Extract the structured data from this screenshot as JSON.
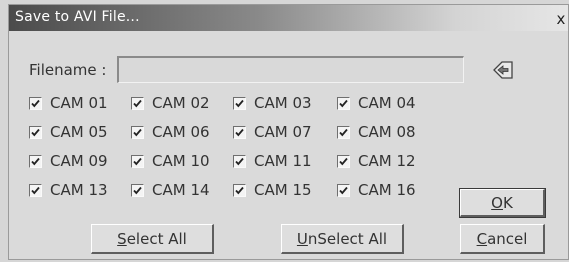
{
  "dialog": {
    "title": "Save to AVI File...",
    "close_label": "x",
    "filename_label": "Filename :",
    "filename_value": "",
    "browse_icon": "browse-folder-icon"
  },
  "cameras": [
    {
      "label": "CAM 01",
      "checked": true
    },
    {
      "label": "CAM 02",
      "checked": true
    },
    {
      "label": "CAM 03",
      "checked": true
    },
    {
      "label": "CAM 04",
      "checked": true
    },
    {
      "label": "CAM 05",
      "checked": true
    },
    {
      "label": "CAM 06",
      "checked": true
    },
    {
      "label": "CAM 07",
      "checked": true
    },
    {
      "label": "CAM 08",
      "checked": true
    },
    {
      "label": "CAM 09",
      "checked": true
    },
    {
      "label": "CAM 10",
      "checked": true
    },
    {
      "label": "CAM 11",
      "checked": true
    },
    {
      "label": "CAM 12",
      "checked": true
    },
    {
      "label": "CAM 13",
      "checked": true
    },
    {
      "label": "CAM 14",
      "checked": true
    },
    {
      "label": "CAM 15",
      "checked": true
    },
    {
      "label": "CAM 16",
      "checked": true
    }
  ],
  "buttons": {
    "select_all": {
      "mnemonic": "S",
      "rest": "elect All"
    },
    "unselect_all": {
      "mnemonic": "U",
      "rest": "nSelect All"
    },
    "ok": {
      "mnemonic": "O",
      "rest": "K"
    },
    "cancel": {
      "mnemonic": "C",
      "rest": "ancel"
    }
  }
}
